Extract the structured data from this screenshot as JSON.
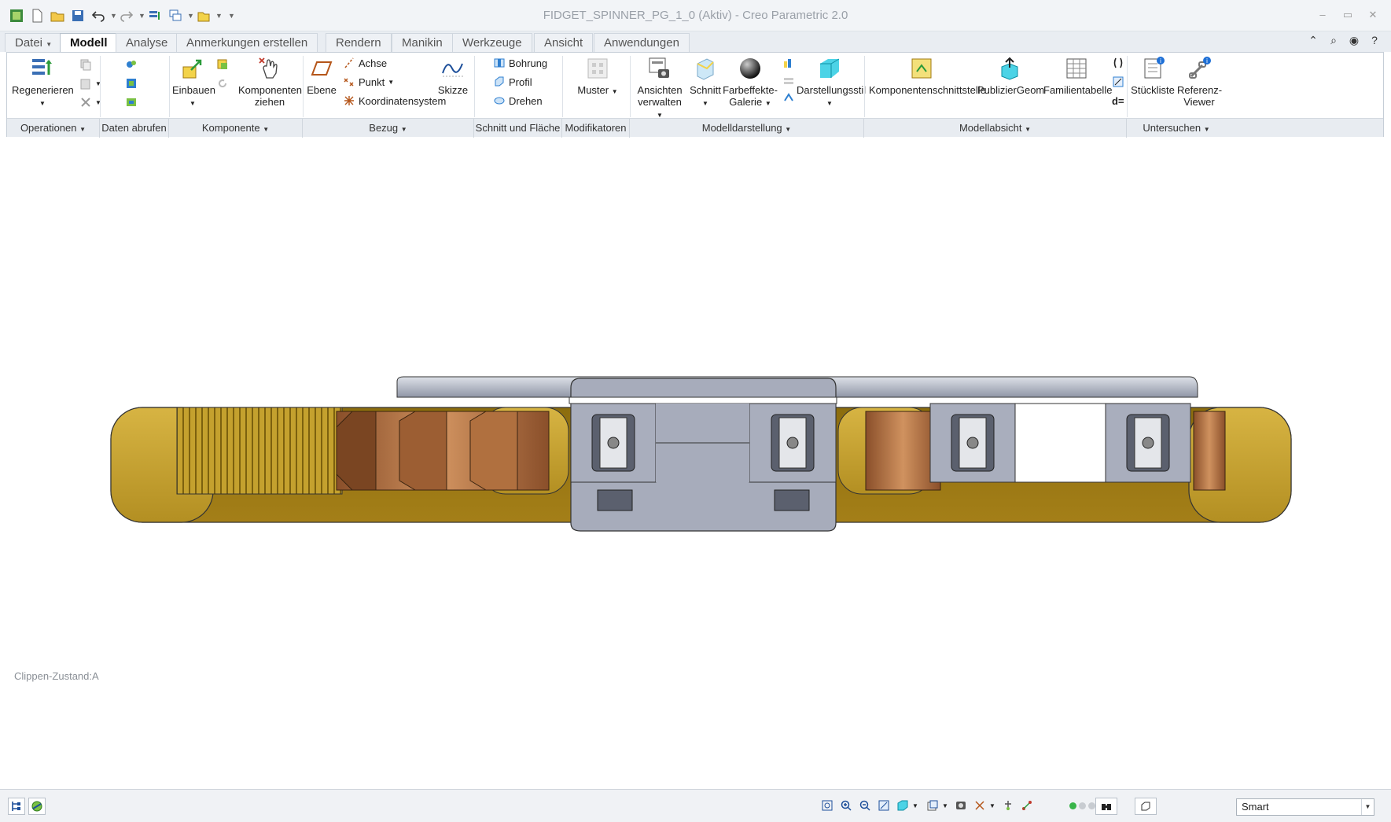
{
  "window": {
    "title": "FIDGET_SPINNER_PG_1_0 (Aktiv) - Creo Parametric 2.0"
  },
  "quick_access": [
    "new-icon",
    "open-icon",
    "save-icon",
    "undo-icon",
    "redo-icon",
    "regenerate-icon",
    "windows-icon",
    "close-icon",
    "customize-icon"
  ],
  "tabs": [
    {
      "label": "Datei"
    },
    {
      "label": "Modell"
    },
    {
      "label": "Analyse"
    },
    {
      "label": "Anmerkungen erstellen"
    },
    {
      "label": "Rendern"
    },
    {
      "label": "Manikin"
    },
    {
      "label": "Werkzeuge"
    },
    {
      "label": "Ansicht"
    },
    {
      "label": "Anwendungen"
    }
  ],
  "active_tab": "Modell",
  "ribbon": {
    "operationen": {
      "regenerieren": "Regenerieren"
    },
    "komponente": {
      "einbauen": "Einbauen",
      "komponenten_ziehen_1": "Komponenten",
      "komponenten_ziehen_2": "ziehen"
    },
    "bezug": {
      "ebene": "Ebene",
      "achse": "Achse",
      "punkt": "Punkt",
      "koordinatensystem": "Koordinatensystem",
      "skizze": "Skizze"
    },
    "schnitt": {
      "bohrung": "Bohrung",
      "profil": "Profil",
      "drehen": "Drehen"
    },
    "modifikatoren": {
      "muster": "Muster"
    },
    "modelldarstellung": {
      "ansichten_1": "Ansichten",
      "ansichten_2": "verwalten",
      "schnitt": "Schnitt",
      "farbeffekte_1": "Farbeffekte-",
      "farbeffekte_2": "Galerie",
      "darstellungsstil": "Darstellungsstil"
    },
    "modellabsicht": {
      "komponentenschnittstelle": "Komponentenschnittstelle",
      "publiziergeom": "PublizierGeom",
      "familientabelle": "Familientabelle",
      "d_equals": "d="
    },
    "untersuchen": {
      "stueckliste": "Stückliste",
      "referenz_1": "Referenz-",
      "referenz_2": "Viewer"
    }
  },
  "groups": [
    {
      "label": "Operationen"
    },
    {
      "label": "Daten abrufen"
    },
    {
      "label": "Komponente"
    },
    {
      "label": "Bezug"
    },
    {
      "label": "Schnitt und Fläche"
    },
    {
      "label": "Modifikatoren"
    },
    {
      "label": "Modelldarstellung"
    },
    {
      "label": "Modellabsicht"
    },
    {
      "label": "Untersuchen"
    }
  ],
  "viewport": {
    "clip_state": "Clippen-Zustand:A"
  },
  "statusbar": {
    "selection_filter": "Smart"
  },
  "colors": {
    "body_gold": "#c4a12e",
    "body_dark_gold": "#9a7a12",
    "bearing_gray": "#a9aebd",
    "copper": "#b7764a",
    "accent_blue": "#1d4f9a"
  }
}
